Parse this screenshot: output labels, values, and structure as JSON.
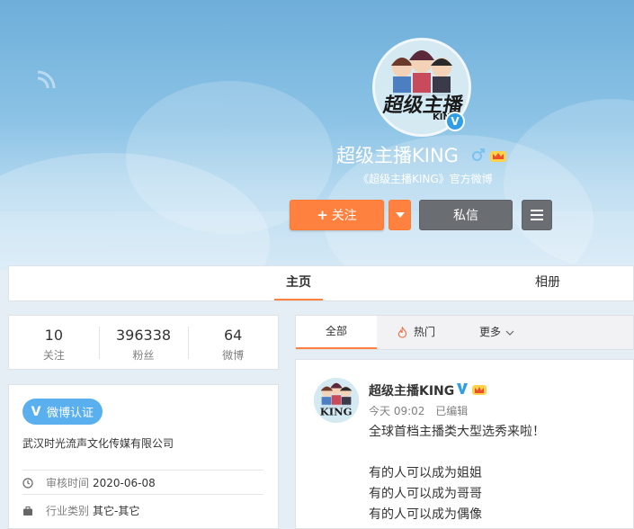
{
  "profile": {
    "name": "超级主播KING",
    "description": "《超级主播KING》官方微博",
    "avatar_text": "超级主播",
    "avatar_sub": "KING"
  },
  "actions": {
    "follow_label": "关注",
    "message_label": "私信"
  },
  "tabs": [
    {
      "label": "主页"
    },
    {
      "label": "相册"
    }
  ],
  "stats": [
    {
      "value": "10",
      "label": "关注"
    },
    {
      "value": "396338",
      "label": "粉丝"
    },
    {
      "value": "64",
      "label": "微博"
    }
  ],
  "info": {
    "cert_label": "微博认证",
    "company": "武汉时光流声文化传媒有限公司",
    "review_label": "审核时间",
    "review_value": "2020-06-08",
    "industry_label": "行业类别",
    "industry_value": "其它-其它"
  },
  "filter": {
    "all_label": "全部",
    "hot_label": "热门",
    "more_label": "更多"
  },
  "post": {
    "author": "超级主播KING",
    "time": "今天 09:02",
    "edited": "已编辑",
    "line1": "全球首档主播类大型选秀来啦！",
    "line2": "有的人可以成为姐姐",
    "line3": "有的人可以成为哥哥",
    "line4": "有的人可以成为偶像"
  },
  "colors": {
    "accent": "#ff8140",
    "verify_blue": "#2f9ee6",
    "dark_button": "#6a6d72"
  }
}
